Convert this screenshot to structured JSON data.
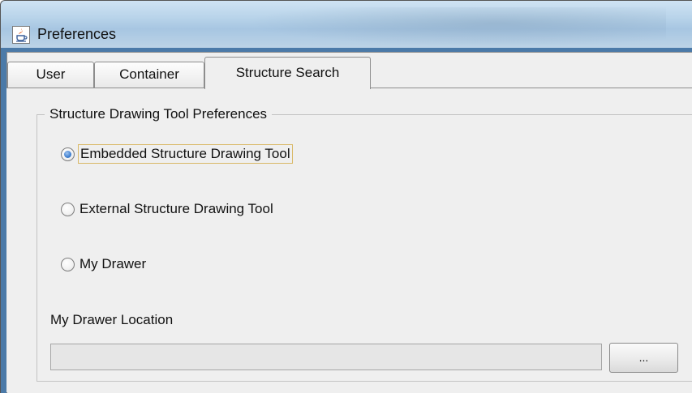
{
  "window": {
    "title": "Preferences",
    "icon": "java-icon"
  },
  "tabs": [
    {
      "label": "User",
      "selected": false
    },
    {
      "label": "Container",
      "selected": false
    },
    {
      "label": "Structure Search",
      "selected": true
    }
  ],
  "group": {
    "title": "Structure Drawing Tool Preferences",
    "options": [
      {
        "label": "Embedded Structure Drawing Tool",
        "selected": true
      },
      {
        "label": "External Structure Drawing Tool",
        "selected": false
      },
      {
        "label": "My Drawer",
        "selected": false
      }
    ]
  },
  "drawer_location": {
    "label": "My Drawer Location",
    "value": "",
    "browse_label": "..."
  },
  "colors": {
    "radio_selected": "#3f7fcf",
    "focus_border": "#d9b866",
    "titlebar": "#b9d4ea"
  }
}
